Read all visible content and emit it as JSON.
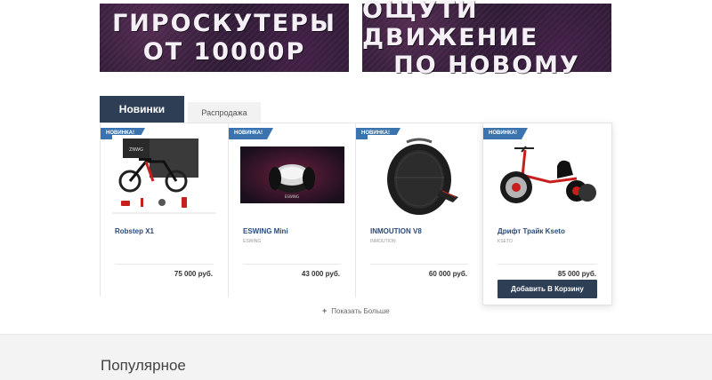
{
  "banners": [
    {
      "line1": "ГИРОСКУТЕРЫ",
      "line2": "ОТ 10000Р"
    },
    {
      "line1": "ОЩУТИ ДВИЖЕНИЕ",
      "line2": "ПО НОВОМУ"
    }
  ],
  "tabs": {
    "active": "Новинки",
    "inactive": "Распродажа"
  },
  "products": [
    {
      "badge": "НОВИНКА!",
      "name": "Robstep X1",
      "brand": "",
      "price": "75 000 руб.",
      "image_icon": "electric-bike-image",
      "screen_text": "ZNWG"
    },
    {
      "badge": "НОВИНКА!",
      "name": "ESWING Mini",
      "brand": "ESWING",
      "price": "43 000 руб.",
      "image_icon": "hoverboard-image",
      "screen_text": "ESWING"
    },
    {
      "badge": "НОВИНКА!",
      "name": "INMOUTION V8",
      "brand": "INMOUTION",
      "price": "60 000 руб.",
      "image_icon": "monowheel-image"
    },
    {
      "badge": "НОВИНКА!",
      "name": "Дрифт Трайк Kseto",
      "brand": "KSETO",
      "price": "85 000 руб.",
      "image_icon": "drift-trike-image",
      "cart_button": "Добавить В Корзину"
    }
  ],
  "show_more": "Показать Больше",
  "popular_title": "Популярное",
  "colors": {
    "accent": "#2e3f55",
    "badge": "#3a73ad",
    "link": "#2a4a78"
  }
}
